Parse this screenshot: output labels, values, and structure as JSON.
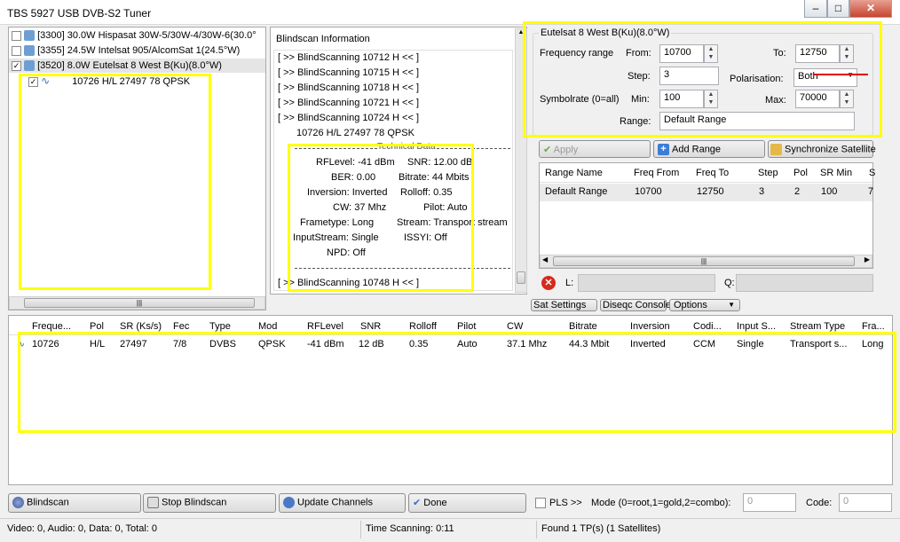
{
  "window": {
    "title": "TBS 5927 USB DVB-S2 Tuner"
  },
  "sat_list": [
    {
      "label": "[3300] 30.0W  Hispasat 30W-5/30W-4/30W-6(30.0°",
      "checked": false
    },
    {
      "label": "[3355] 24.5W  Intelsat 905/AlcomSat 1(24.5°W)",
      "checked": false
    },
    {
      "label": "[3520] 8.0W  Eutelsat 8 West B(Ku)(8.0°W)",
      "checked": true
    }
  ],
  "tp_item": "10726 H/L 27497 78 QPSK",
  "blindscan": {
    "header": "Blindscan Information",
    "lines": [
      "[ >> BlindScanning 10712 H << ]",
      "[ >> BlindScanning 10715 H << ]",
      "[ >> BlindScanning 10718 H << ]",
      "[ >> BlindScanning 10721 H << ]",
      "[ >> BlindScanning 10724 H << ]"
    ],
    "found": "10726 H/L 27497 78 QPSK",
    "tech_title": "Technical Data",
    "rflevel": "RFLevel: -41 dBm",
    "snr": "SNR: 12.00 dB",
    "ber": "BER: 0.00",
    "bitrate": "Bitrate:   44 Mbits",
    "inversion": "Inversion: Inverted",
    "rolloff": "Rolloff: 0.35",
    "cw": "CW:  37 Mhz",
    "pilot": "Pilot: Auto",
    "frametype": "Frametype: Long",
    "stream": "Stream: Transport stream",
    "inputstream": "InputStream: Single",
    "issyi": "ISSYI: Off",
    "npd": "NPD: Off",
    "last_line": "[ >> BlindScanning 10748 H << ]"
  },
  "settings": {
    "group": "Eutelsat 8 West B(Ku)(8.0°W)",
    "freq_range": "Frequency range",
    "from_label": "From:",
    "from_value": "10700",
    "to_label": "To:",
    "to_value": "12750",
    "step_label": "Step:",
    "step_value": "3",
    "pol_label": "Polarisation:",
    "pol_value": "Both",
    "sym_label": "Symbolrate (0=all)",
    "min_label": "Min:",
    "min_value": "100",
    "max_label": "Max:",
    "max_value": "70000",
    "range_label": "Range:",
    "range_value": "Default Range"
  },
  "range_toolbar": {
    "apply": "Apply",
    "add": "Add Range",
    "sync": "Synchronize Satellite"
  },
  "range_table": {
    "headers": [
      "Range Name",
      "Freq From",
      "Freq To",
      "Step",
      "Pol",
      "SR Min",
      "S"
    ],
    "row": [
      "Default Range",
      "10700",
      "12750",
      "3",
      "2",
      "100",
      "7"
    ]
  },
  "lq": {
    "l": "L:",
    "q": "Q:"
  },
  "tabs": {
    "sat": "Sat Settings",
    "diseqc": "Diseqc Console",
    "options": "Options"
  },
  "results": {
    "headers": [
      "Freque...",
      "Pol",
      "SR (Ks/s)",
      "Fec",
      "Type",
      "Mod",
      "RFLevel",
      "SNR",
      "Rolloff",
      "Pilot",
      "CW",
      "Bitrate",
      "Inversion",
      "Codi...",
      "Input S...",
      "Stream Type",
      "Fra..."
    ],
    "row": [
      "10726",
      "H/L",
      "27497",
      "7/8",
      "DVBS",
      "QPSK",
      "-41 dBm",
      "12 dB",
      "0.35",
      "Auto",
      "37.1 Mhz",
      "44.3 Mbit",
      "Inverted",
      "CCM",
      "Single",
      "Transport s...",
      "Long"
    ]
  },
  "bottom": {
    "blindscan": "Blindscan",
    "stop": "Stop Blindscan",
    "update": "Update Channels",
    "done": "Done",
    "pls": "PLS >>",
    "mode": "Mode (0=root,1=gold,2=combo):",
    "mode_value": "0",
    "code": "Code:",
    "code_value": "0"
  },
  "statusbar": {
    "counts": "Video: 0, Audio: 0, Data: 0, Total: 0",
    "time": "Time Scanning: 0:11",
    "found": "Found 1 TP(s) (1 Satellites)"
  }
}
